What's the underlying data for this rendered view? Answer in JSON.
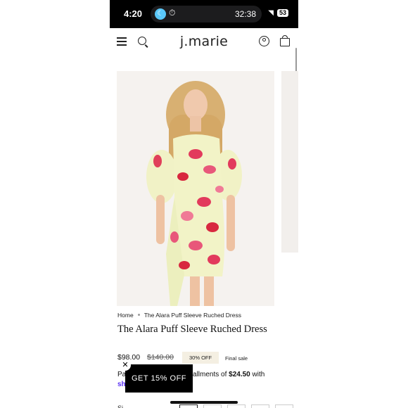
{
  "status_bar": {
    "time": "4:20",
    "timer": "32:38",
    "battery": "53"
  },
  "header": {
    "logo": "j.marie"
  },
  "product": {
    "breadcrumb_home": "Home",
    "breadcrumb_current": "The Alara Puff Sleeve Ruched Dress",
    "title": "The Alara Puff Sleeve Ruched Dress",
    "price": "$98.00",
    "compare_price": "$140.00",
    "discount_badge": "30% OFF",
    "final_sale": "Final sale",
    "installments_prefix": "Pa",
    "installments_text": "tallments of",
    "installment_amount": "$24.50",
    "installments_suffix": "with",
    "shop_pay": "sh",
    "size_label": "Si"
  },
  "popup": {
    "label": "GET 15% OFF",
    "close": "✕"
  },
  "colors": {
    "badge_bg": "#f4efe2",
    "shop_pay": "#5a31f4",
    "popup_bg": "#000000"
  }
}
